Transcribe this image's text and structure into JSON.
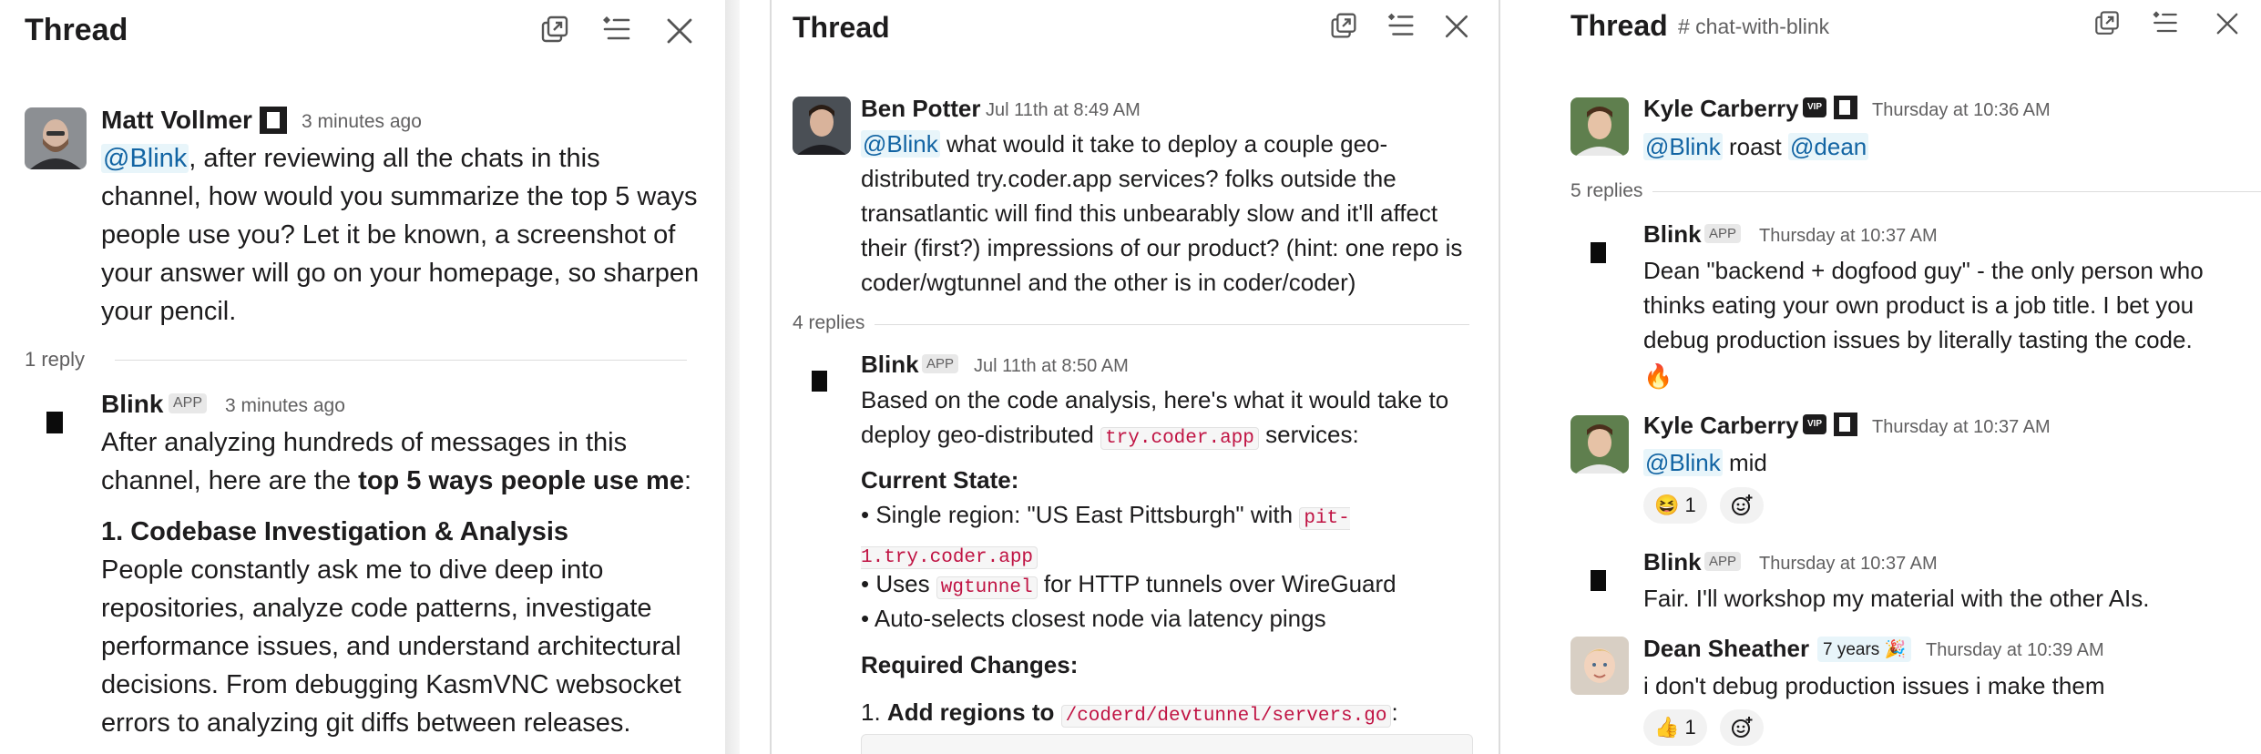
{
  "panels": [
    {
      "header": {
        "title": "Thread"
      },
      "root": {
        "author": "Matt Vollmer",
        "timestamp": "3 minutes ago",
        "mention": "@Blink",
        "text": ", after reviewing all the chats in this channel, how would you summarize the top 5 ways people use you? Let it be known, a screenshot of your answer will go on your homepage, so sharpen your pencil."
      },
      "replies_label": "1 reply",
      "reply": {
        "author": "Blink",
        "badge": "APP",
        "timestamp": "3 minutes ago",
        "intro_a": "After analyzing hundreds of messages in this channel, here are the ",
        "intro_bold": "top 5 ways people use me",
        "intro_b": ":",
        "item1_title": "1. Codebase Investigation & Analysis",
        "item1_text": "People constantly ask me to dive deep into repositories, analyze code patterns, investigate performance issues, and understand architectural decisions. From debugging KasmVNC websocket errors to analyzing git diffs between releases."
      }
    },
    {
      "header": {
        "title": "Thread"
      },
      "root": {
        "author": "Ben Potter",
        "timestamp": "Jul 11th at 8:49 AM",
        "mention": "@Blink",
        "text": " what would it take to deploy a couple geo-distributed try.coder.app services? folks outside the transatlantic will find this unbearably slow and it'll affect their (first?) impressions of our product? (hint: one repo is coder/wgtunnel and the other is in coder/coder)"
      },
      "replies_label": "4 replies",
      "reply": {
        "author": "Blink",
        "badge": "APP",
        "timestamp": "Jul 11th at 8:50 AM",
        "intro": "Based on the code analysis, here's what it would take to deploy geo-distributed ",
        "intro_code": "try.coder.app",
        "intro_end": " services:",
        "current_title": "Current State:",
        "b1_a": "• Single region: \"US East Pittsburgh\" with ",
        "b1_code": "pit-1.try.coder.app",
        "b2_a": "• Uses ",
        "b2_code": "wgtunnel",
        "b2_b": " for HTTP tunnels over WireGuard",
        "b3": "• Auto-selects closest node via latency pings",
        "required_title": "Required Changes:",
        "step1_num": "1. ",
        "step1_bold": "Add regions to ",
        "step1_code": "/coderd/devtunnel/servers.go",
        "step1_end": ":"
      }
    },
    {
      "header": {
        "title": "Thread",
        "channel": "# chat-with-blink"
      },
      "root": {
        "author": "Kyle Carberry",
        "vip": "VIP",
        "timestamp": "Thursday at 10:36 AM",
        "mention1": "@Blink",
        "word": " roast ",
        "mention2": "@dean"
      },
      "replies_label": "5 replies",
      "messages": [
        {
          "author": "Blink",
          "badge": "APP",
          "timestamp": "Thursday at 10:37 AM",
          "text": "Dean \"backend + dogfood guy\" - the only person who thinks eating your own product is a job title. I bet you debug production issues by literally tasting the code.",
          "emoji": "🔥"
        },
        {
          "author": "Kyle Carberry",
          "vip": "VIP",
          "timestamp": "Thursday at 10:37 AM",
          "mention": "@Blink",
          "text": " mid",
          "reaction": {
            "emoji": "😆",
            "count": "1"
          }
        },
        {
          "author": "Blink",
          "badge": "APP",
          "timestamp": "Thursday at 10:37 AM",
          "text": "Fair. I'll workshop my material with the other AIs."
        },
        {
          "author": "Dean Sheather",
          "tenure": "7 years 🎉",
          "timestamp": "Thursday at 10:39 AM",
          "text": "i don't debug production issues i make them",
          "reaction": {
            "emoji": "👍",
            "count": "1"
          }
        }
      ]
    }
  ],
  "colors": {
    "mention": "#1264a3",
    "mention_bg": "#e8f5fa",
    "code": "#c01343",
    "muted": "#616061"
  }
}
